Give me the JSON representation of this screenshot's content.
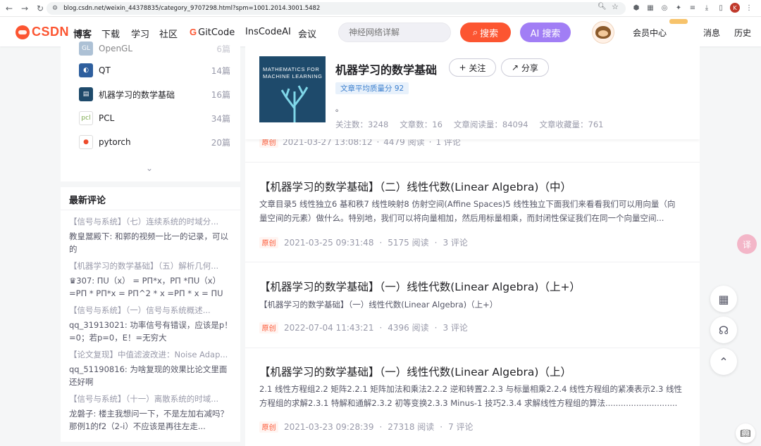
{
  "browser": {
    "url": "blog.csdn.net/weixin_44378835/category_9707298.html?spm=1001.2014.3001.5482",
    "profile_initial": "K"
  },
  "toolbar": {
    "logo": "CSDN",
    "nav": [
      "博客",
      "下载",
      "学习",
      "社区",
      "GitCode",
      "InsCodeAI",
      "会议"
    ],
    "search_placeholder": "神经网络详解",
    "search_label": "搜索",
    "ai_search_label": "AI 搜索",
    "right": [
      "会员中心",
      "消息",
      "历史"
    ]
  },
  "sidebar": {
    "categories": [
      {
        "name": "OpenGL",
        "count": "6篇",
        "icon": "opengl-icon",
        "color": "#6b8fb3"
      },
      {
        "name": "QT",
        "count": "14篇",
        "icon": "qt-icon",
        "color": "#2e5f9e"
      },
      {
        "name": "机器学习的数学基础",
        "count": "16篇",
        "icon": "book-icon",
        "color": "#1e4a6b"
      },
      {
        "name": "PCL",
        "count": "34篇",
        "icon": "pcl-icon",
        "color": "#7aa84a"
      },
      {
        "name": "pytorch",
        "count": "20篇",
        "icon": "pytorch-icon",
        "color": "#ee4c2c"
      }
    ]
  },
  "comments": {
    "title": "最新评论",
    "items": [
      {
        "source": "【信号与系统】（七）连续系统的时域分...",
        "text": "教皇翯殿下: 和郭的视频一比一的记录，可以的"
      },
      {
        "source": "【机器学习的数学基础】（五）解析几何...",
        "text": "♛307: ΠU（x） = PΠ*x，PΠ *ΠU（x）=PΠ * PΠ*x = PΠ^2 * x =PΠ * x = ΠU（x）..."
      },
      {
        "source": "【信号与系统】（一）信号与系统概述...",
        "text": "qq_31913021: 功率信号有错误，应该是p！=0；若p=0，E！=无穷大"
      },
      {
        "source": "【论文复现】中值滤波改进：Noise Adap...",
        "text": "qq_51190816: 为啥复现的效果比论文里面还好啊"
      },
      {
        "source": "【信号与系统】（十一）离散系统的时域...",
        "text": "龙磐子: 楼主我想问一下，不是左加右减吗？那例1的f2（2-i）不应该是再往左走..."
      }
    ]
  },
  "column": {
    "book_title": "MATHEMATICS FOR MACHINE LEARNING",
    "title": "机器学习的数学基础",
    "follow_label": "关注",
    "share_label": "分享",
    "quality": "文章平均质量分 92",
    "desc": "。",
    "stats": [
      "关注数：3248",
      "文章数：16",
      "文章阅读量：84094",
      "文章收藏量：761"
    ]
  },
  "peek": {
    "date": "2021-03-27 13:08:12",
    "reads": "4479 阅读",
    "comments": "1 评论"
  },
  "articles": [
    {
      "title": "【机器学习的数学基础】（二）线性代数(Linear Algebra)（中）",
      "desc": "文章目录5 线性独立6 基和秩7 线性映射8 仿射空间(Affine Spaces)5 线性独立下面我们来看看我们可以用向量（向量空间的元素）做什么。特别地，我们可以将向量相加，然后用标量相乘，而封闭性保证我们在同一个向量空间...",
      "tag": "原创",
      "date": "2021-03-25 09:31:48",
      "reads": "5175 阅读",
      "comments": "3 评论"
    },
    {
      "title": "【机器学习的数学基础】（一）线性代数(Linear Algebra)（上+）",
      "desc": "【机器学习的数学基础】（一）线性代数(Linear Algebra)（上+）",
      "tag": "原创",
      "date": "2022-07-04 11:43:21",
      "reads": "4396 阅读",
      "comments": "3 评论"
    },
    {
      "title": "【机器学习的数学基础】（一）线性代数(Linear Algebra)（上）",
      "desc": "2.1 线性方程组2.2 矩阵2.2.1 矩阵加法和乘法2.2.2 逆和转置2.2.3 与标量相乘2.2.4 线性方程组的紧凑表示2.3 线性方程组的求解2.3.1 特解和通解2.3.2 初等变换2.3.3 Minus-1 技巧2.3.4 求解线性方程组的算法............................",
      "tag": "原创",
      "date": "2021-03-23 09:28:39",
      "reads": "27318 阅读",
      "comments": "7 评论"
    }
  ],
  "floaters": {
    "translate": "译"
  }
}
